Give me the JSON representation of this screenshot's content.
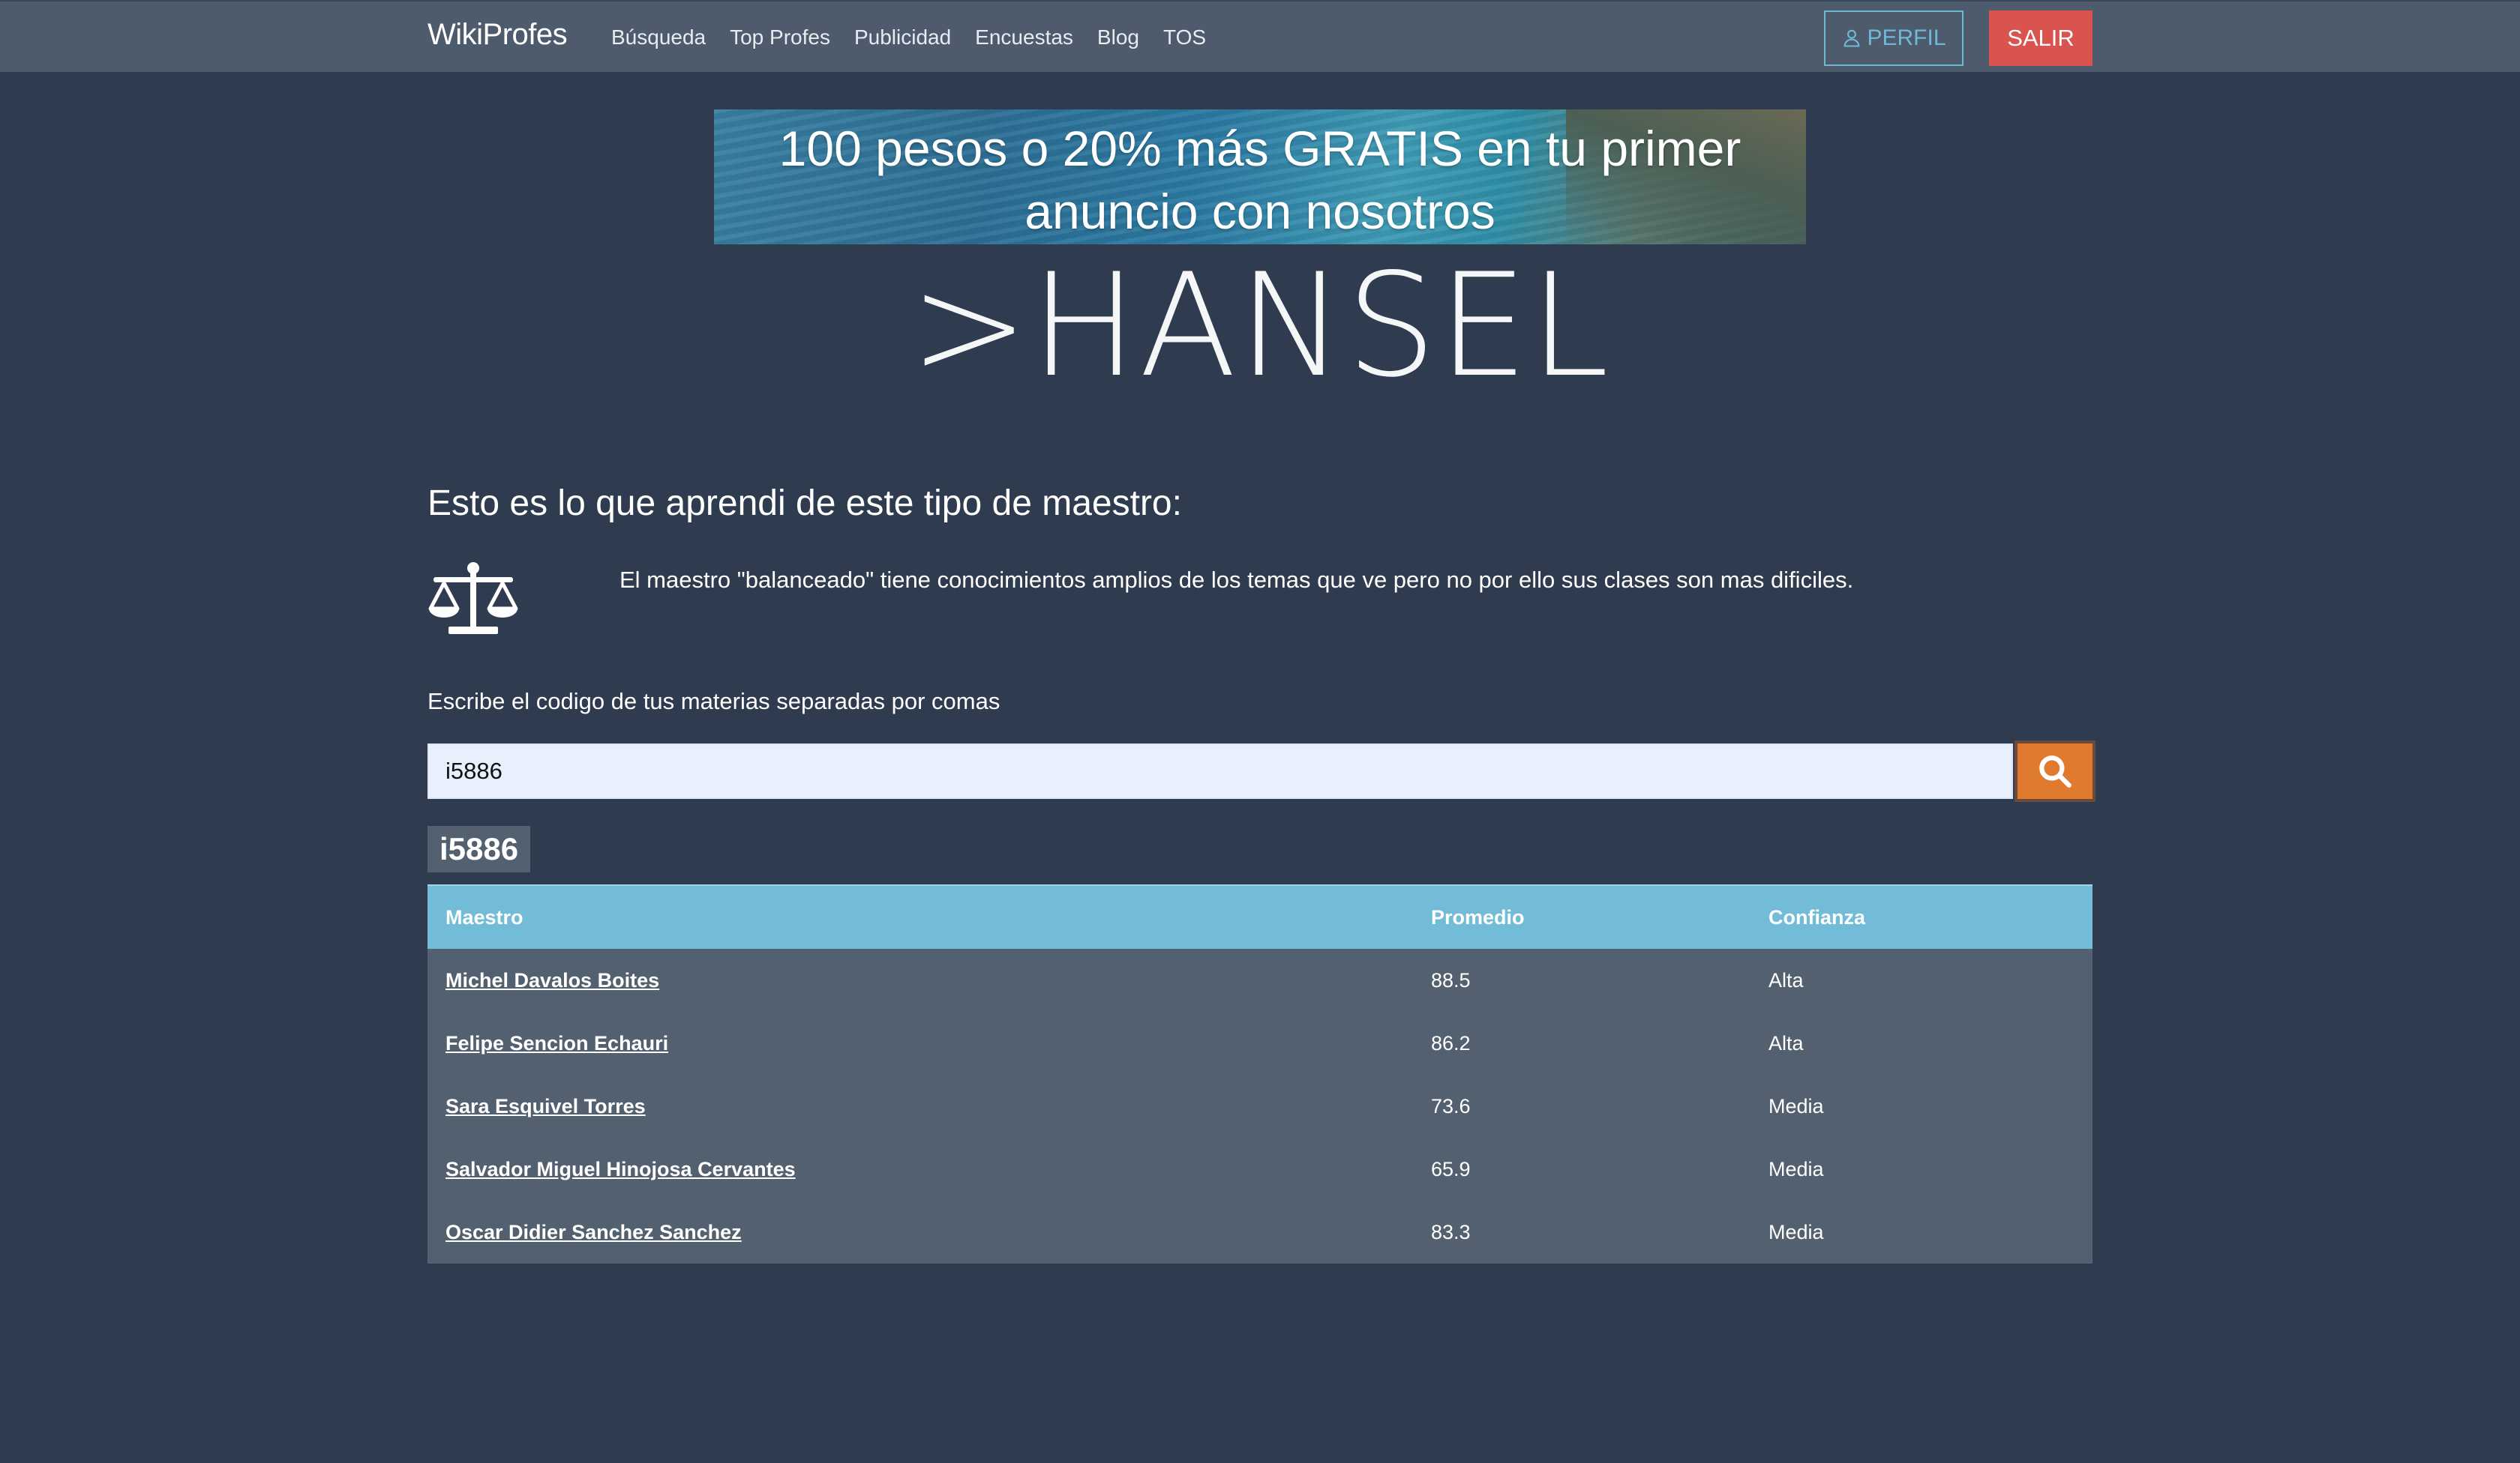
{
  "navbar": {
    "brand": "WikiProfes",
    "links": [
      "Búsqueda",
      "Top Profes",
      "Publicidad",
      "Encuestas",
      "Blog",
      "TOS"
    ],
    "perfil_label": "PERFIL",
    "salir_label": "SALIR"
  },
  "banner": {
    "line1": "100 pesos o 20% más GRATIS en tu primer",
    "line2": "anuncio con nosotros"
  },
  "profile": {
    "title": ">HANSEL"
  },
  "section": {
    "heading": "Esto es lo que aprendi de este tipo de maestro:",
    "icon": "balance-scale-icon",
    "description": "El maestro \"balanceado\" tiene conocimientos amplios de los temas que ve pero no por ello sus clases son mas dificiles."
  },
  "search": {
    "label": "Escribe el codigo de tus materias separadas por comas",
    "value": "i5886",
    "button_icon": "search-icon"
  },
  "results": {
    "code": "i5886",
    "headers": [
      "Maestro",
      "Promedio",
      "Confianza"
    ],
    "rows": [
      {
        "maestro": "Michel Davalos Boites",
        "promedio": "88.5",
        "confianza": "Alta"
      },
      {
        "maestro": "Felipe Sencion Echauri",
        "promedio": "86.2",
        "confianza": "Alta"
      },
      {
        "maestro": "Sara Esquivel Torres",
        "promedio": "73.6",
        "confianza": "Media"
      },
      {
        "maestro": "Salvador Miguel Hinojosa Cervantes",
        "promedio": "65.9",
        "confianza": "Media"
      },
      {
        "maestro": "Oscar Didier Sanchez Sanchez",
        "promedio": "83.3",
        "confianza": "Media"
      }
    ]
  },
  "colors": {
    "background": "#2f3b4e",
    "navbar": "#4d5b6d",
    "table_header": "#72bcd8",
    "salir": "#d9534f",
    "search_button": "#e07a2e"
  }
}
